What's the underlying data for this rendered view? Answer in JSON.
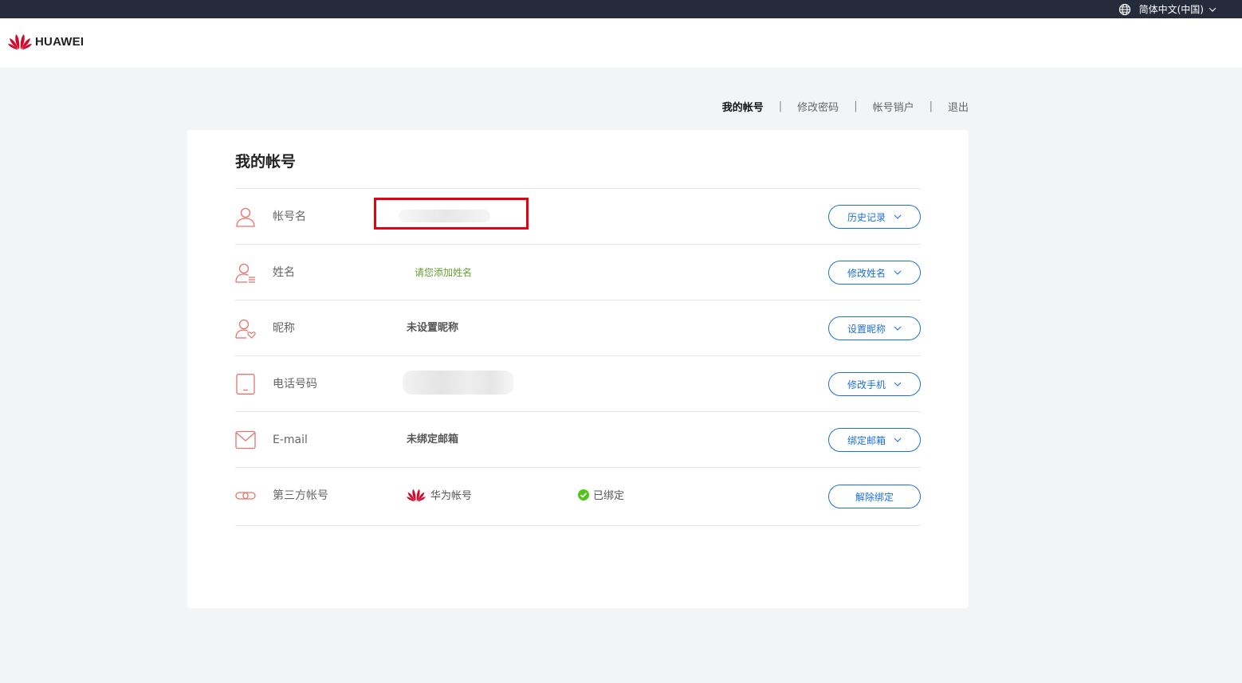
{
  "topbar": {
    "language": "简体中文(中国)"
  },
  "header": {
    "logo_text": "HUAWEI"
  },
  "nav": {
    "items": [
      {
        "label": "我的帐号",
        "active": true
      },
      {
        "label": "修改密码",
        "active": false
      },
      {
        "label": "帐号销户",
        "active": false
      },
      {
        "label": "退出",
        "active": false
      }
    ],
    "separator": "|"
  },
  "card": {
    "title": "我的帐号",
    "rows": [
      {
        "icon": "user-icon",
        "label": "帐号名",
        "value": "",
        "button": "历史记录"
      },
      {
        "icon": "user-list-icon",
        "label": "姓名",
        "value": "请您添加姓名",
        "button": "修改姓名"
      },
      {
        "icon": "user-heart-icon",
        "label": "昵称",
        "value": "未设置昵称",
        "button": "设置昵称"
      },
      {
        "icon": "phone-icon",
        "label": "电话号码",
        "value": "",
        "button": "修改手机"
      },
      {
        "icon": "mail-icon",
        "label": "E-mail",
        "value": "未绑定邮箱",
        "button": "绑定邮箱"
      },
      {
        "icon": "link-icon",
        "label": "第三方帐号",
        "value": "华为帐号",
        "status": "已绑定",
        "button": "解除绑定"
      }
    ]
  },
  "colors": {
    "accent": "#1d6fd8",
    "icon": "#e8736e",
    "brand": "#cf0a2c",
    "success": "#52c41a",
    "highlight": "#e60012"
  }
}
